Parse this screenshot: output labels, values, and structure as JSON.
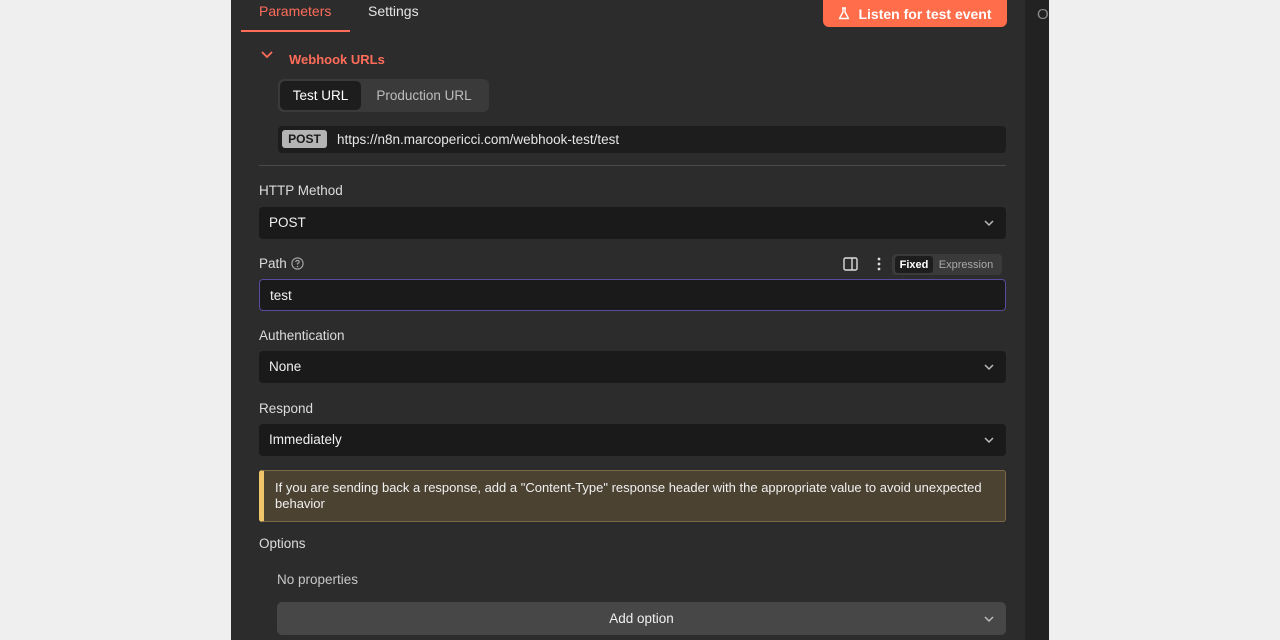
{
  "tabs": {
    "parameters": "Parameters",
    "settings": "Settings"
  },
  "side_letter": "O",
  "listen_button": {
    "label": "Listen for test event",
    "color": "#ff6d4a"
  },
  "webhook_urls": {
    "title": "Webhook URLs",
    "url_tabs": {
      "test": "Test URL",
      "production": "Production URL"
    },
    "method_badge": "POST",
    "url": "https://n8n.marcopericci.com/webhook-test/test"
  },
  "http_method": {
    "label": "HTTP Method",
    "value": "POST"
  },
  "path": {
    "label": "Path",
    "value": "test",
    "mode_fixed": "Fixed",
    "mode_expression": "Expression"
  },
  "authentication": {
    "label": "Authentication",
    "value": "None"
  },
  "respond": {
    "label": "Respond",
    "value": "Immediately"
  },
  "notice": {
    "text": "If you are sending back a response, add a \"Content-Type\" response header with the appropriate value to avoid unexpected behavior"
  },
  "options": {
    "label": "Options",
    "empty_text": "No properties",
    "add_button": "Add option"
  },
  "colors": {
    "accent": "#ff6d5a",
    "panel": "#2c2c2c",
    "warning_bar": "#f1c56a"
  }
}
